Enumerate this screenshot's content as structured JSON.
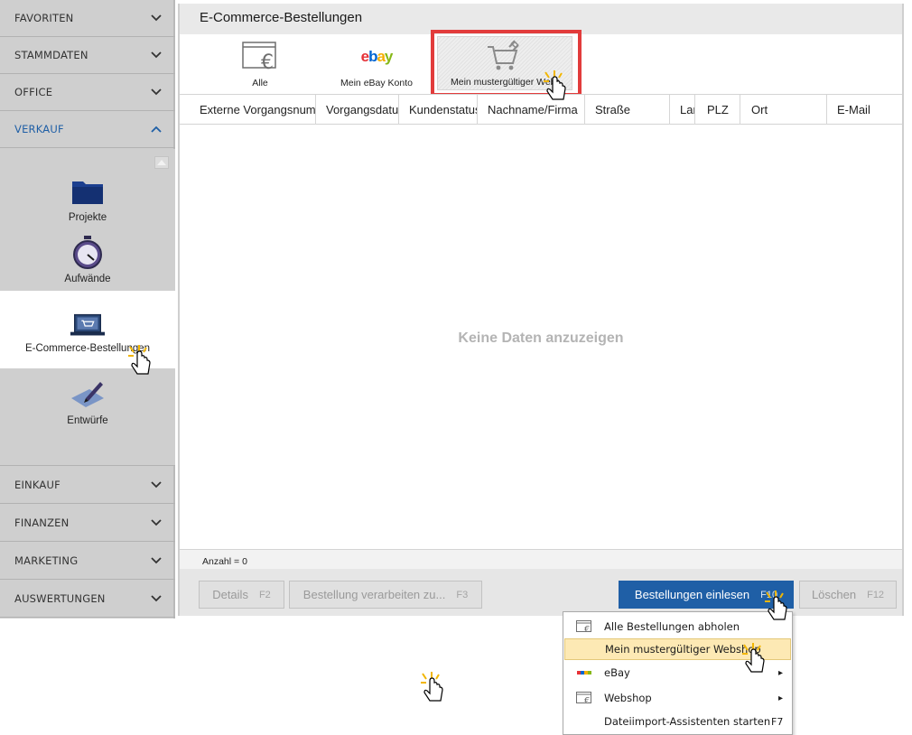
{
  "sidebar": {
    "sections_top": [
      {
        "label": "FAVORITEN"
      },
      {
        "label": "STAMMDATEN"
      },
      {
        "label": "OFFICE"
      },
      {
        "label": "VERKAUF"
      }
    ],
    "verkauf_items": [
      {
        "label": "Projekte",
        "icon": "folder-icon"
      },
      {
        "label": "Aufwände",
        "icon": "stopwatch-icon"
      },
      {
        "label": "E-Commerce-Bestellungen",
        "icon": "laptop-cart-icon"
      },
      {
        "label": "Entwürfe",
        "icon": "pen-draft-icon"
      }
    ],
    "sections_bottom": [
      {
        "label": "EINKAUF"
      },
      {
        "label": "FINANZEN"
      },
      {
        "label": "MARKETING"
      },
      {
        "label": "AUSWERTUNGEN"
      }
    ]
  },
  "main": {
    "title": "E-Commerce-Bestellungen",
    "tabs": [
      {
        "label": "Alle",
        "icon": "euro-window-icon"
      },
      {
        "label": "Mein eBay Konto",
        "icon": "ebay-logo-icon",
        "logo_text": [
          "e",
          "b",
          "a",
          "y"
        ]
      },
      {
        "label": "Mein mustergültiger Webshop",
        "icon": "cart-link-icon"
      }
    ],
    "columns": [
      "Externe Vorgangsnummer",
      "Vorgangsdatum",
      "Kundenstatus",
      "Nachname/Firma",
      "Straße",
      "Land",
      "PLZ",
      "Ort",
      "E-Mail"
    ],
    "empty_message": "Keine Daten anzuzeigen",
    "count_label": "Anzahl = 0",
    "buttons": {
      "details": {
        "label": "Details",
        "key": "F2"
      },
      "process": {
        "label": "Bestellung verarbeiten zu...",
        "key": "F3"
      },
      "import": {
        "label": "Bestellungen einlesen",
        "key": "F10"
      },
      "delete": {
        "label": "Löschen",
        "key": "F12"
      }
    }
  },
  "menu": {
    "items": [
      {
        "label": "Alle Bestellungen abholen",
        "icon": "euro-window-icon",
        "right": ""
      },
      {
        "label": "Mein mustergültiger Webshop",
        "icon": "",
        "right": ""
      },
      {
        "label": "eBay",
        "icon": "ebay-logo-icon",
        "right": "▸"
      },
      {
        "label": "Webshop",
        "icon": "euro-window-icon",
        "right": "▸"
      },
      {
        "label": "Dateiimport-Assistenten starten",
        "icon": "",
        "right": "F7"
      }
    ]
  },
  "colors": {
    "accent": "#1f5fa6",
    "highlight_box": "#e23c3c",
    "menu_hover": "#fde9b4",
    "sidebar_bg": "#cfcfcf"
  }
}
